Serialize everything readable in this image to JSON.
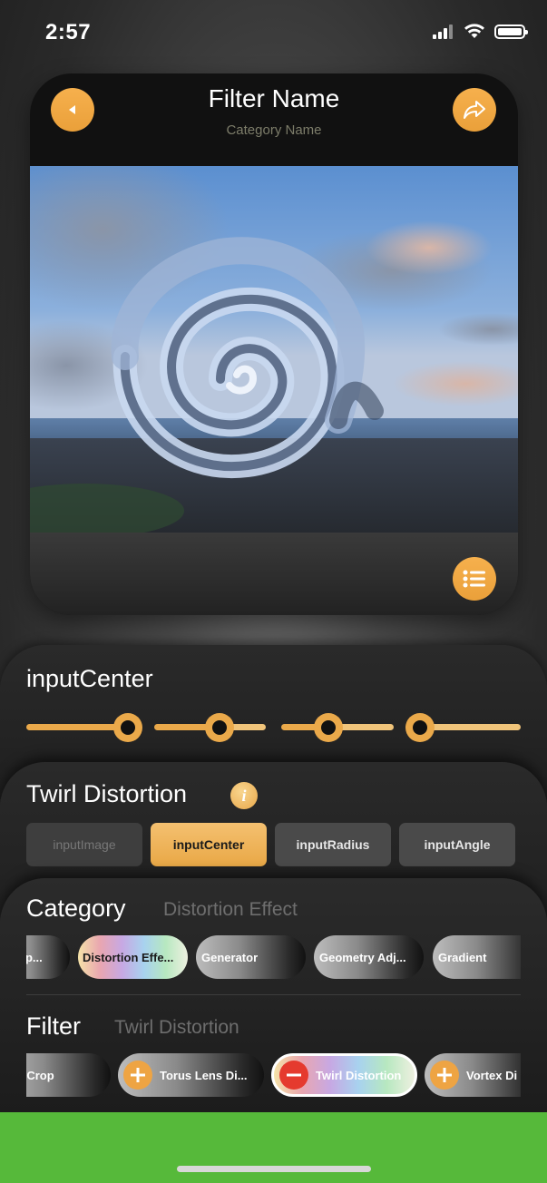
{
  "status_bar": {
    "time": "2:57"
  },
  "header": {
    "title": "Filter Name",
    "category": "Category Name"
  },
  "parameter": {
    "name": "inputCenter",
    "slider_values": [
      0.8,
      0.6,
      0.4,
      0.1
    ]
  },
  "filter_panel": {
    "title": "Twirl Distortion",
    "tabs": [
      "inputImage",
      "inputCenter",
      "inputRadius",
      "inputAngle"
    ]
  },
  "category_section": {
    "heading": "Category",
    "selected": "Distortion Effect",
    "chips": [
      "e Op...",
      "Distortion Effe...",
      "Generator",
      "Geometry Adj...",
      "Gradient"
    ]
  },
  "filter_section": {
    "heading": "Filter",
    "selected": "Twirl Distortion",
    "chips": [
      "etch Crop",
      "Torus Lens Di...",
      "Twirl Distortion",
      "Vortex Di"
    ]
  },
  "colors": {
    "accent": "#eaa94a",
    "danger": "#e53a2e",
    "bottom_bar": "#56b93a"
  }
}
